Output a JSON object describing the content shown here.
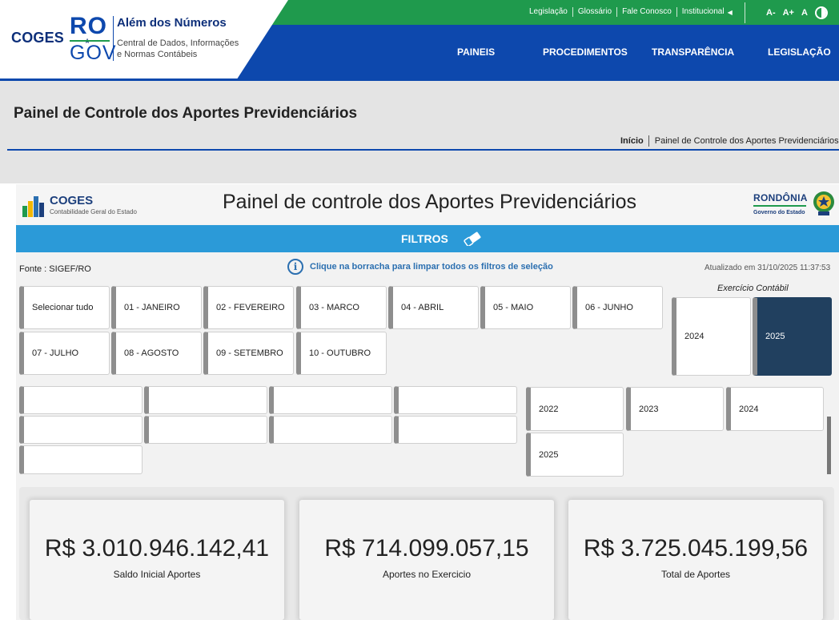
{
  "site": {
    "coges": "COGES",
    "ro": "RO",
    "gov": "GOV",
    "tagline": "Além dos Números",
    "subtitle_line1": "Central de Dados, Informações",
    "subtitle_line2": "e Normas Contábeis"
  },
  "top_links": [
    "Legislação",
    "Glossário",
    "Fale Conosco",
    "Institucional"
  ],
  "font_controls": {
    "decrease": "A-",
    "increase": "A+",
    "normal": "A"
  },
  "nav": [
    "PAINEIS",
    "PROCEDIMENTOS",
    "TRANSPARÊNCIA",
    "LEGISLAÇÃO"
  ],
  "page": {
    "title": "Painel de Controle dos Aportes Previdenciários",
    "breadcrumb": [
      "Início",
      "Painel de Controle dos Aportes Previdenciários"
    ]
  },
  "report": {
    "logo_name": "COGES",
    "logo_sub": "Contabilidade Geral do Estado",
    "title": "Painel de controle dos Aportes Previdenciários",
    "ro_name": "RONDÔNIA",
    "ro_sub": "Governo do Estado",
    "filters_label": "FILTROS",
    "source": "Fonte : SIGEF/RO",
    "hint": "Clique na borracha para limpar todos os filtros de seleção",
    "updated": "Atualizado em 31/10/2025 11:37:53",
    "months": [
      "Selecionar tudo",
      "01 - JANEIRO",
      "02 - FEVEREIRO",
      "03 - MARCO",
      "04 - ABRIL",
      "05 - MAIO",
      "06 - JUNHO",
      "07 - JULHO",
      "08 - AGOSTO",
      "09 - SETEMBRO",
      "10 - OUTUBRO"
    ],
    "exercicio_label": "Exercício Contábil",
    "exercicio_options": [
      "2024",
      "2025"
    ],
    "exercicio_selected": "2025",
    "year_options": [
      "2022",
      "2023",
      "2024",
      "2025"
    ],
    "kpis": [
      {
        "value": "R$ 3.010.946.142,41",
        "label": "Saldo Inicial Aportes"
      },
      {
        "value": "R$ 714.099.057,15",
        "label": "Aportes no Exercicio"
      },
      {
        "value": "R$ 3.725.045.199,56",
        "label": "Total de Aportes"
      }
    ]
  },
  "colors": {
    "green": "#1f9a4d",
    "blue": "#0d48ad",
    "filter_bar": "#2b9ad8",
    "selected_slicer": "#21405f"
  }
}
